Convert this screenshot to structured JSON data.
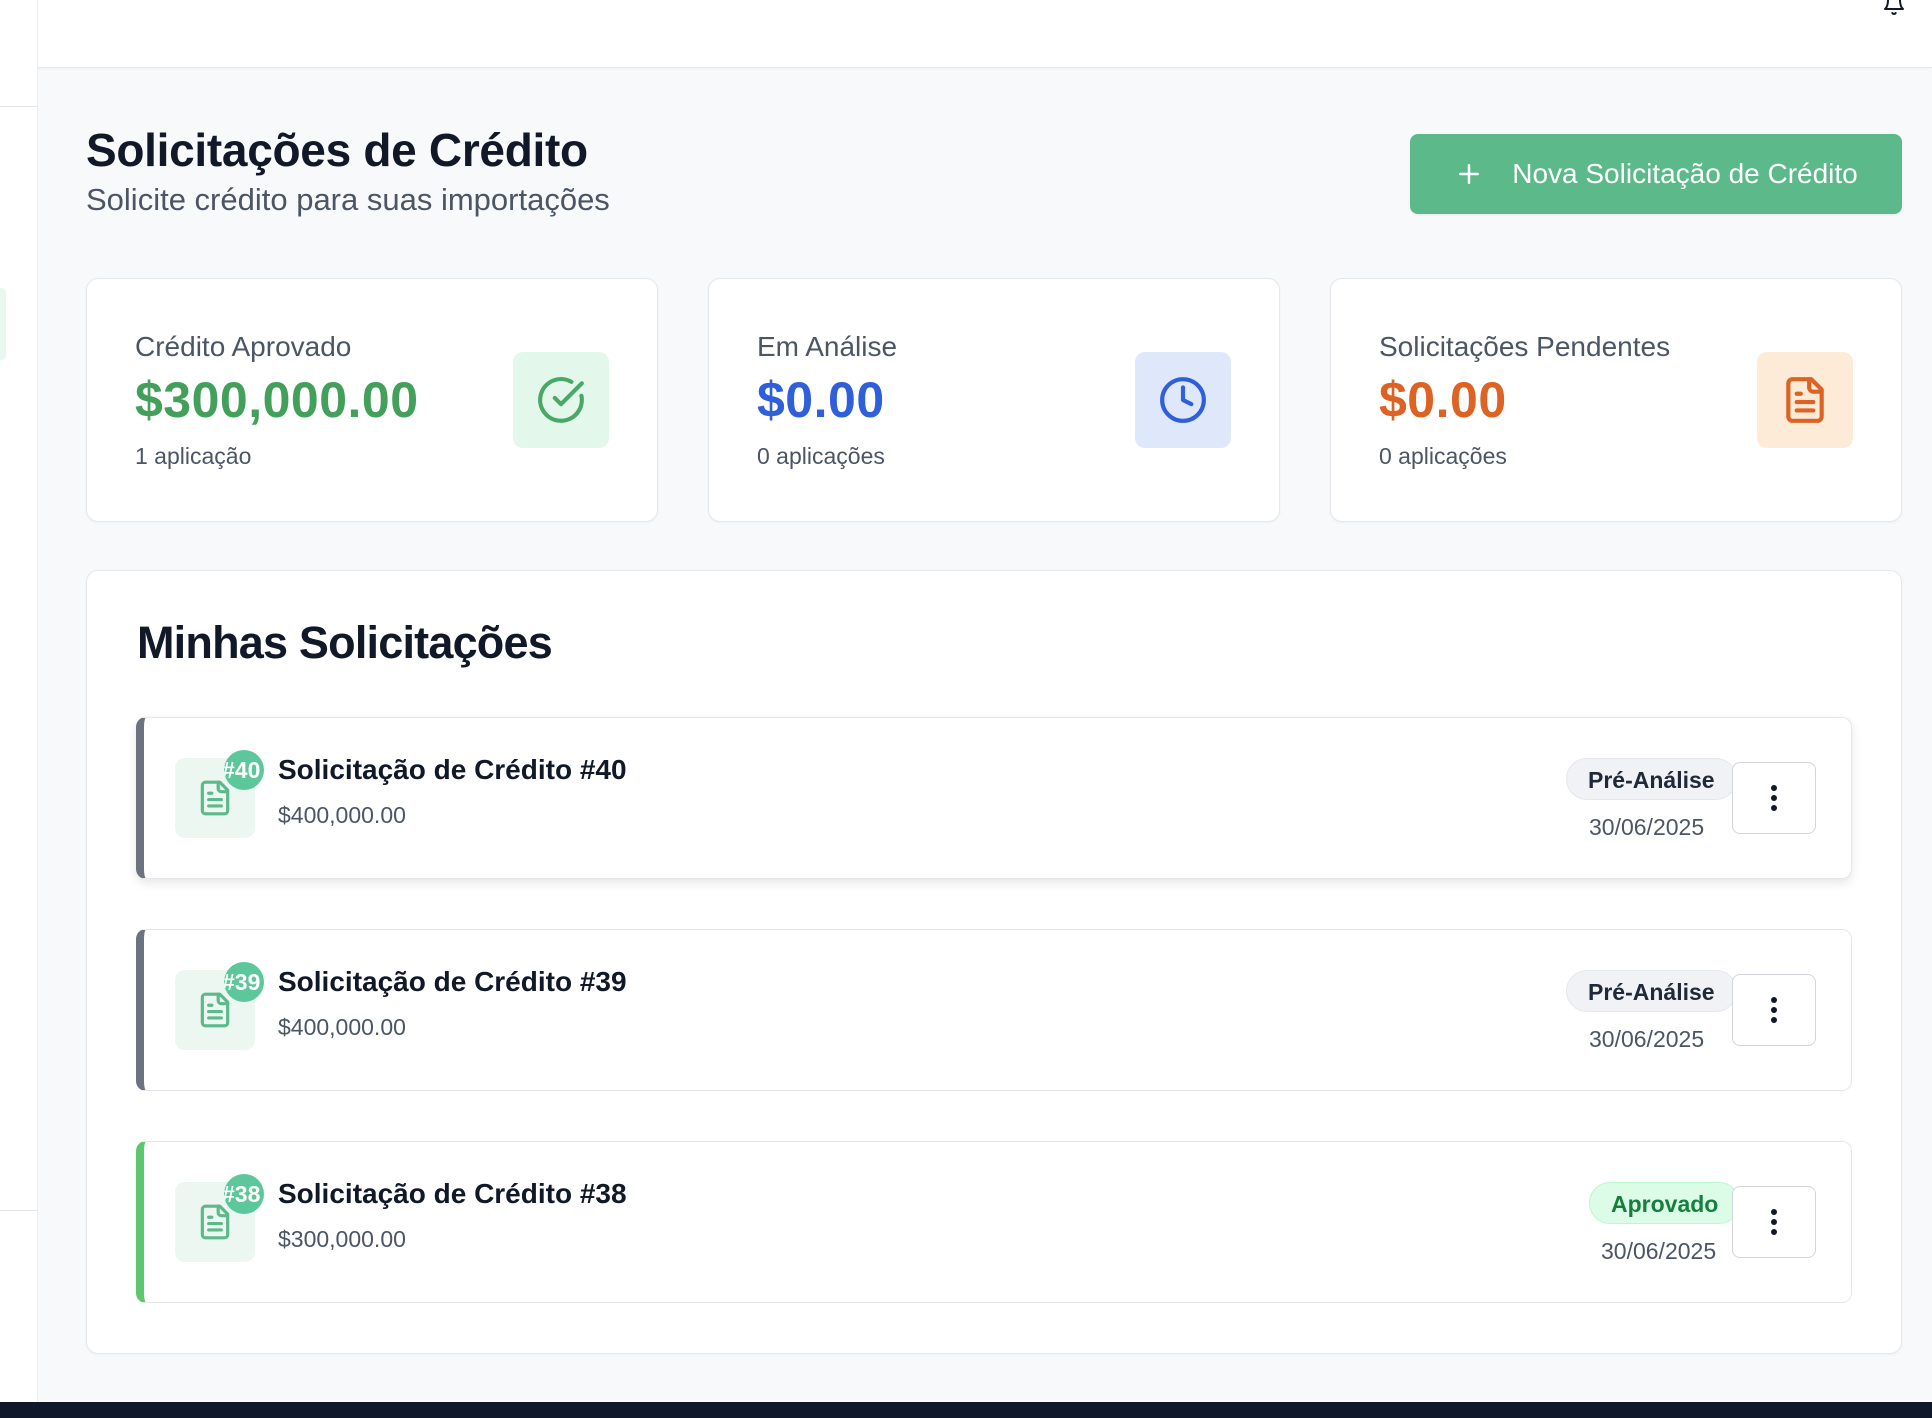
{
  "page": {
    "title": "Solicitações de Crédito",
    "subtitle": "Solicite crédito para suas importações",
    "new_button_label": "Nova Solicitação de Crédito"
  },
  "stats": [
    {
      "label": "Crédito Aprovado",
      "value": "$300,000.00",
      "sub": "1 aplicação",
      "color": "#43a05b",
      "icon": "check-circle-icon",
      "icon_bg": "#e3f8ea"
    },
    {
      "label": "Em Análise",
      "value": "$0.00",
      "sub": "0 aplicações",
      "color": "#2f5fd9",
      "icon": "clock-icon",
      "icon_bg": "#dfe8fb"
    },
    {
      "label": "Solicitações Pendentes",
      "value": "$0.00",
      "sub": "0 aplicações",
      "color": "#dc6324",
      "icon": "document-icon",
      "icon_bg": "#fdebd8"
    }
  ],
  "list": {
    "title": "Minhas Solicitações",
    "items": [
      {
        "badge": "#40",
        "title": "Solicitação de Crédito #40",
        "amount": "$400,000.00",
        "status": "Pré-Análise",
        "date": "30/06/2025",
        "accent": "#6b7280"
      },
      {
        "badge": "#39",
        "title": "Solicitação de Crédito #39",
        "amount": "$400,000.00",
        "status": "Pré-Análise",
        "date": "30/06/2025",
        "accent": "#6b7280"
      },
      {
        "badge": "#38",
        "title": "Solicitação de Crédito #38",
        "amount": "$300,000.00",
        "status": "Aprovado",
        "date": "30/06/2025",
        "accent": "#5cc76c"
      }
    ]
  }
}
